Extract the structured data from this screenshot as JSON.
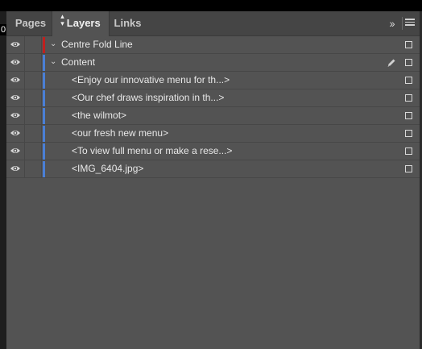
{
  "ruler_marker": "0",
  "tabs": [
    {
      "label": "Pages"
    },
    {
      "label": "Layers",
      "active": true
    },
    {
      "label": "Links"
    }
  ],
  "panel": {
    "collapse_icon": "double-chevron-right-icon",
    "menu_icon": "hamburger-menu-icon"
  },
  "colors": {
    "panel_bg": "#535353",
    "centre_fold_layer": "#c0201e",
    "content_layer": "#4a7fd6"
  },
  "layers": [
    {
      "name": "Centre Fold Line",
      "color": "#c0201e",
      "expanded": true,
      "visible": true,
      "pen": false,
      "items": []
    },
    {
      "name": "Content",
      "color": "#4a7fd6",
      "expanded": true,
      "visible": true,
      "pen": true,
      "items": [
        {
          "name": "<Enjoy our innovative menu for th...>"
        },
        {
          "name": "<Our chef draws inspiration in th...>"
        },
        {
          "name": "<the wilmot>"
        },
        {
          "name": "<our fresh new menu>"
        },
        {
          "name": "<To view full menu or make a rese...>"
        },
        {
          "name": "<IMG_6404.jpg>"
        }
      ]
    }
  ]
}
